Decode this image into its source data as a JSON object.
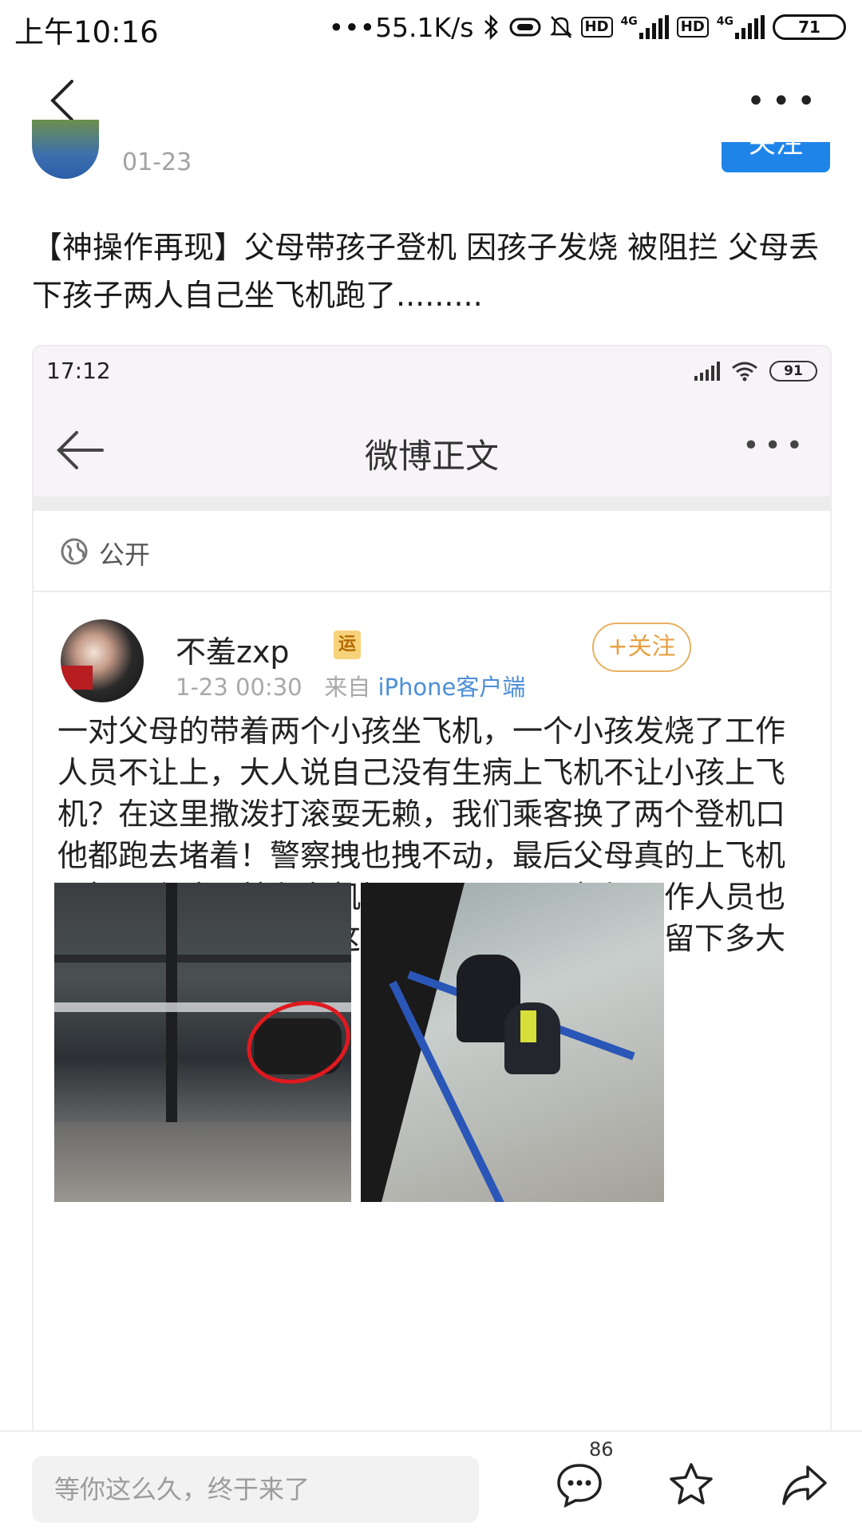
{
  "status_bar": {
    "time": "上午10:16",
    "network_speed": "•••55.1K/s",
    "battery": "71",
    "icons": [
      "bluetooth-icon",
      "vibrate-icon",
      "mute-icon",
      "hd-icon",
      "signal-4g-icon",
      "hd-icon",
      "signal-4g-icon"
    ],
    "hd_label": "HD",
    "net_label": "4G"
  },
  "header": {
    "back_icon": "chevron-left-icon",
    "more_label": "•••"
  },
  "post": {
    "date": "01-23",
    "follow_label": "关注",
    "text": "【神操作再现】父母带孩子登机 因孩子发烧 被阻拦 父母丢下孩子两人自己坐飞机跑了........."
  },
  "embedded_screenshot": {
    "status_time": "17:12",
    "battery": "91",
    "title": "微博正文",
    "more_label": "•••",
    "visibility": "公开",
    "user": {
      "name": "不羞zxp",
      "badge": "运",
      "time": "1-23 00:30",
      "from_label": "来自",
      "source": "iPhone客户端",
      "follow_label": "+关注"
    },
    "text_part1": "一对父母的带着两个小孩坐飞机，一个小孩发烧了工作人员不让上，大人说自己没有生病上飞机不让小孩上飞机？在这里撒泼打滚耍无赖，我们乘客换了两个登机口他都跑去堵着！警察拽也拽不动，最后父母真的上飞机了把两个孩子就留在机场……",
    "text_part2": "，机场工作人员也很蒙圈，只能先照顾这一儿一女，这得给孩子留下多大的阴影？",
    "photos": [
      "airport-gate-photo",
      "airport-children-photo"
    ]
  },
  "bottom_bar": {
    "comment_placeholder": "等你这么久，终于来了",
    "comment_count": "86",
    "icons": [
      "comment-icon",
      "star-icon",
      "share-icon"
    ]
  },
  "colors": {
    "accent_blue": "#1f84e8",
    "follow_orange": "#e8a043",
    "link_blue": "#4d8fd6"
  }
}
